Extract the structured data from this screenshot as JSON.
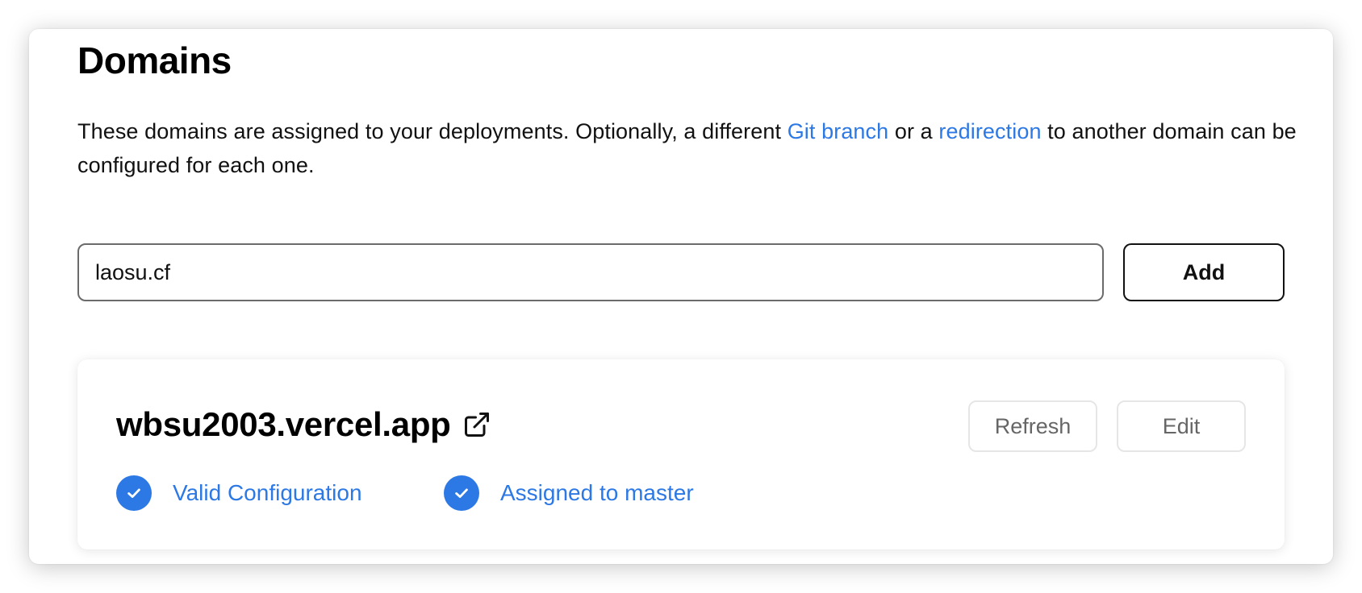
{
  "page": {
    "title": "Domains",
    "description": {
      "before": "These domains are assigned to your deployments. Optionally, a different ",
      "git_link": "Git branch",
      "middle": " or a ",
      "redirect_link": "redirection",
      "after": " to another domain can be configured for each one."
    }
  },
  "add_form": {
    "input_value": "laosu.cf",
    "add_label": "Add"
  },
  "domain_card": {
    "domain": "wbsu2003.vercel.app",
    "refresh_label": "Refresh",
    "edit_label": "Edit",
    "statuses": [
      {
        "label": "Valid Configuration",
        "icon": "check-circle-icon"
      },
      {
        "label": "Assigned to master",
        "icon": "check-circle-icon"
      }
    ]
  },
  "colors": {
    "accent": "#2c78e4",
    "text": "#111111",
    "muted_button_text": "#666666",
    "border": "#6b6b6b"
  }
}
